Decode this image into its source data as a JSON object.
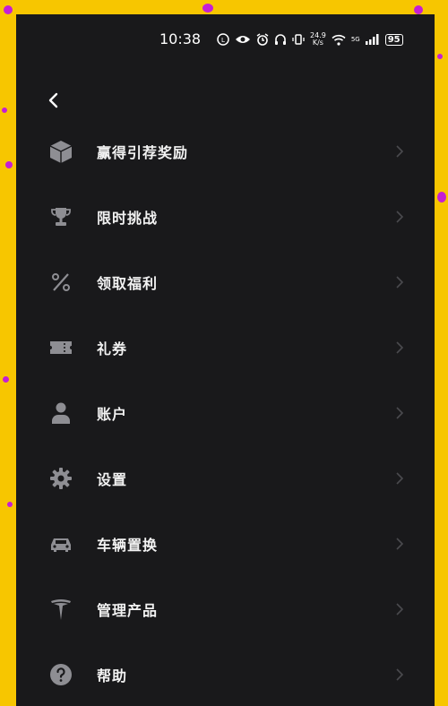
{
  "status_bar": {
    "time": "10:38",
    "speed_value": "24.9",
    "speed_unit": "K/s",
    "network": "5G",
    "battery": "95"
  },
  "header": {
    "back_icon": "chevron-left-icon"
  },
  "menu": {
    "items": [
      {
        "label": "赢得引荐奖励",
        "icon": "box-icon"
      },
      {
        "label": "限时挑战",
        "icon": "trophy-icon"
      },
      {
        "label": "领取福利",
        "icon": "percent-icon"
      },
      {
        "label": "礼券",
        "icon": "ticket-icon"
      },
      {
        "label": "账户",
        "icon": "person-icon"
      },
      {
        "label": "设置",
        "icon": "gear-icon"
      },
      {
        "label": "车辆置换",
        "icon": "car-icon"
      },
      {
        "label": "管理产品",
        "icon": "tesla-logo-icon"
      },
      {
        "label": "帮助",
        "icon": "help-icon"
      }
    ]
  },
  "colors": {
    "background": "#19191b",
    "frame": "#f7c600",
    "text": "#f2f2f2",
    "icon": "#8e8e93",
    "chevron": "#4a4a4e"
  }
}
